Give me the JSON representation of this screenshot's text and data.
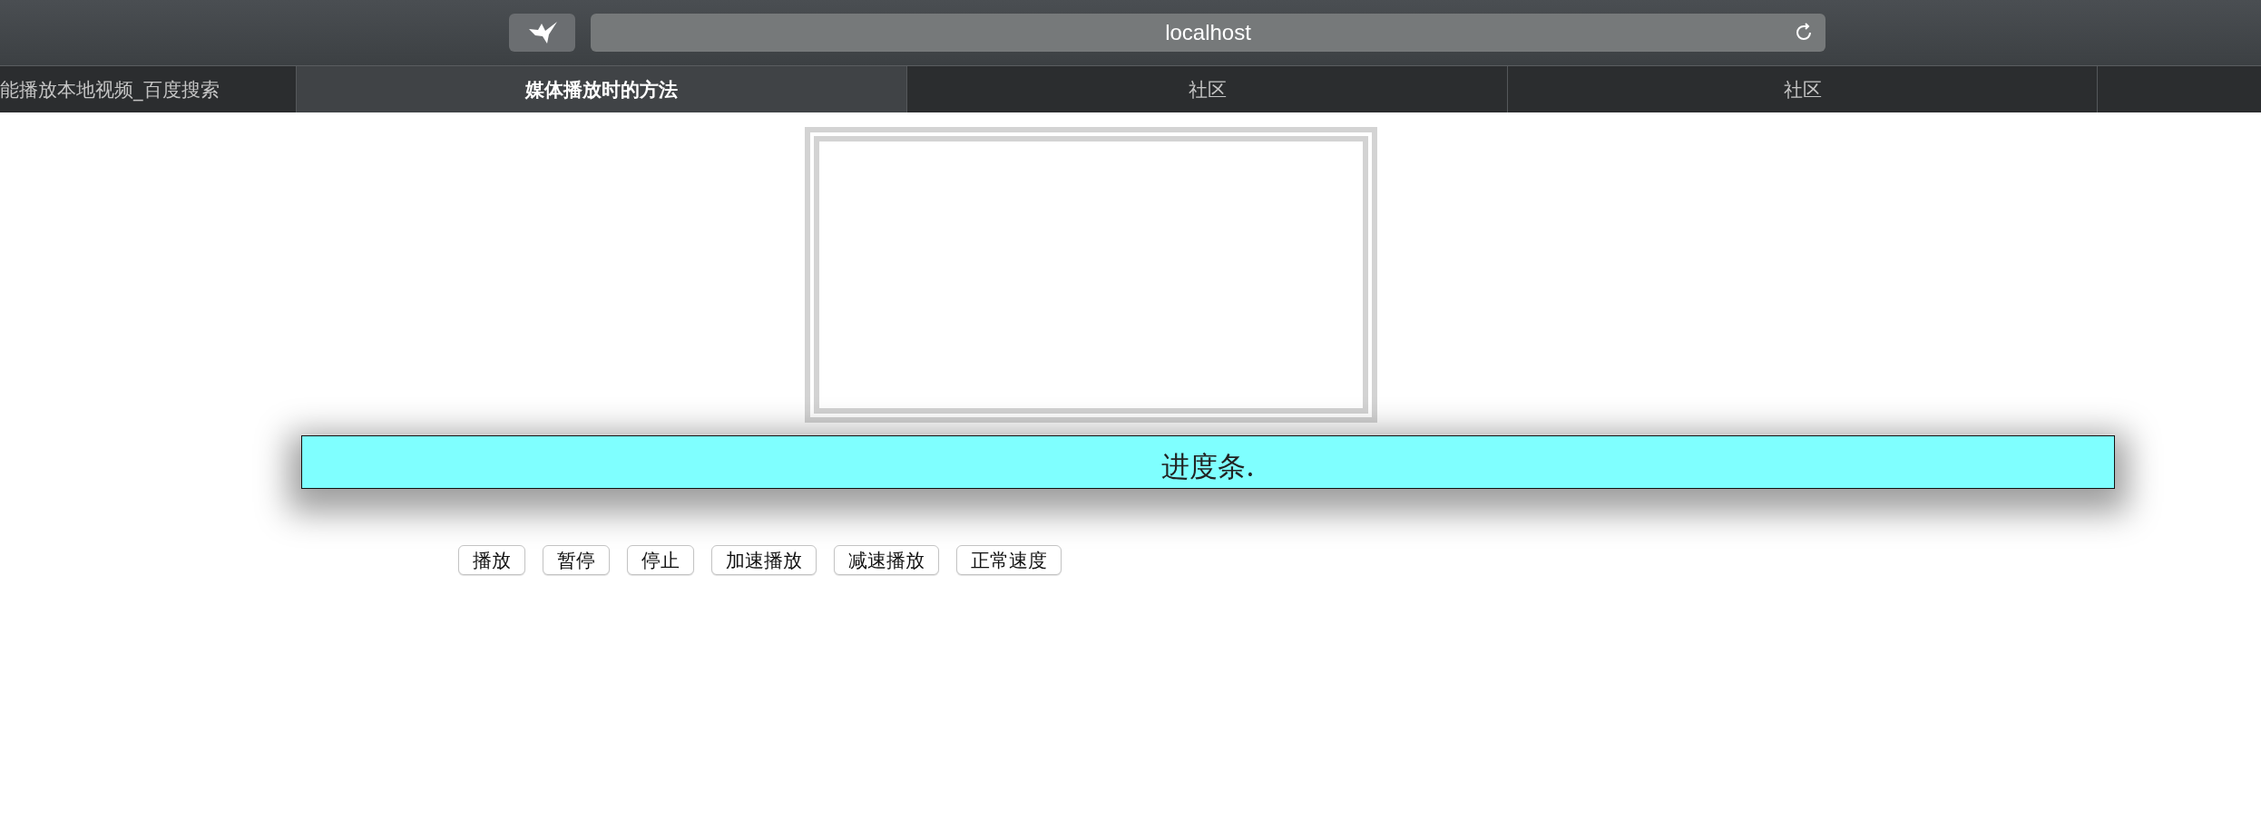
{
  "browser": {
    "url": "localhost"
  },
  "tabs": [
    {
      "label": "能播放本地视频_百度搜索",
      "selected": false
    },
    {
      "label": "媒体播放时的方法",
      "selected": true
    },
    {
      "label": "社区",
      "selected": false
    },
    {
      "label": "社区",
      "selected": false
    }
  ],
  "progress_bar": {
    "label": "进度条."
  },
  "buttons": [
    "播放",
    "暂停",
    "停止",
    "加速播放",
    "减速播放",
    "正常速度"
  ]
}
